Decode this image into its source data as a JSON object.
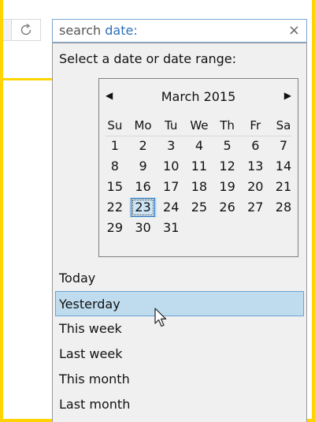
{
  "search": {
    "prefix": "search",
    "keyword": "date:",
    "clear_glyph": "×"
  },
  "panel": {
    "title": "Select a date or date range:"
  },
  "calendar": {
    "month_label": "March 2015",
    "prev_glyph": "◀",
    "next_glyph": "▶",
    "weekdays": [
      "Su",
      "Mo",
      "Tu",
      "We",
      "Th",
      "Fr",
      "Sa"
    ],
    "weeks": [
      [
        "1",
        "2",
        "3",
        "4",
        "5",
        "6",
        "7"
      ],
      [
        "8",
        "9",
        "10",
        "11",
        "12",
        "13",
        "14"
      ],
      [
        "15",
        "16",
        "17",
        "18",
        "19",
        "20",
        "21"
      ],
      [
        "22",
        "23",
        "24",
        "25",
        "26",
        "27",
        "28"
      ],
      [
        "29",
        "30",
        "31",
        "",
        "",
        "",
        ""
      ]
    ],
    "today": "23"
  },
  "options": [
    {
      "label": "Today",
      "selected": false
    },
    {
      "label": "Yesterday",
      "selected": true
    },
    {
      "label": "This week",
      "selected": false
    },
    {
      "label": "Last week",
      "selected": false
    },
    {
      "label": "This month",
      "selected": false
    },
    {
      "label": "Last month",
      "selected": false
    }
  ],
  "colors": {
    "frame": "#ffd400",
    "accent": "#2c6fb7",
    "selection": "#bfdcee"
  }
}
